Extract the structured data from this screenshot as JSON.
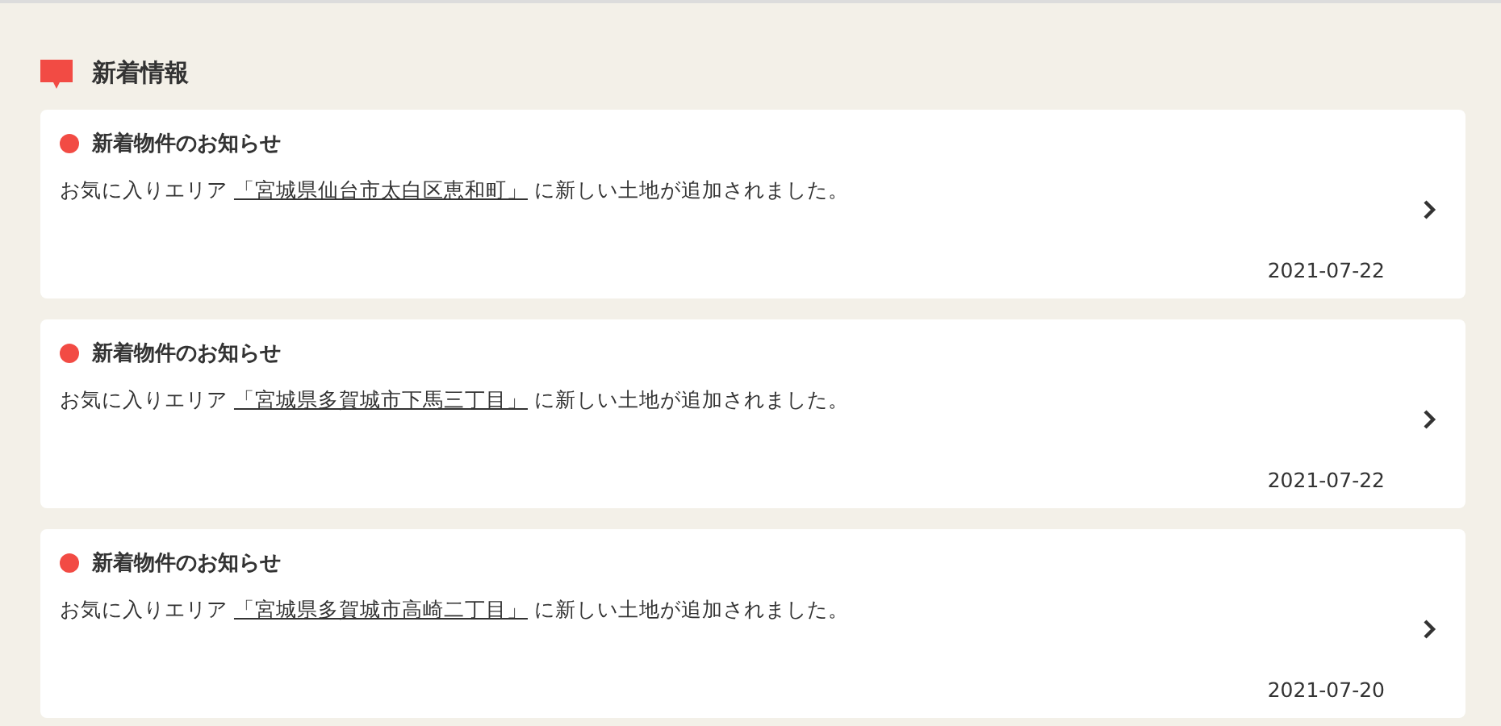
{
  "section": {
    "title": "新着情報"
  },
  "notices": [
    {
      "title": "新着物件のお知らせ",
      "prefix": "お気に入りエリア ",
      "link": "「宮城県仙台市太白区恵和町」",
      "suffix": " に新しい土地が追加されました。",
      "date": "2021-07-22"
    },
    {
      "title": "新着物件のお知らせ",
      "prefix": "お気に入りエリア ",
      "link": "「宮城県多賀城市下馬三丁目」",
      "suffix": " に新しい土地が追加されました。",
      "date": "2021-07-22"
    },
    {
      "title": "新着物件のお知らせ",
      "prefix": "お気に入りエリア ",
      "link": "「宮城県多賀城市高崎二丁目」",
      "suffix": " に新しい土地が追加されました。",
      "date": "2021-07-20"
    }
  ]
}
